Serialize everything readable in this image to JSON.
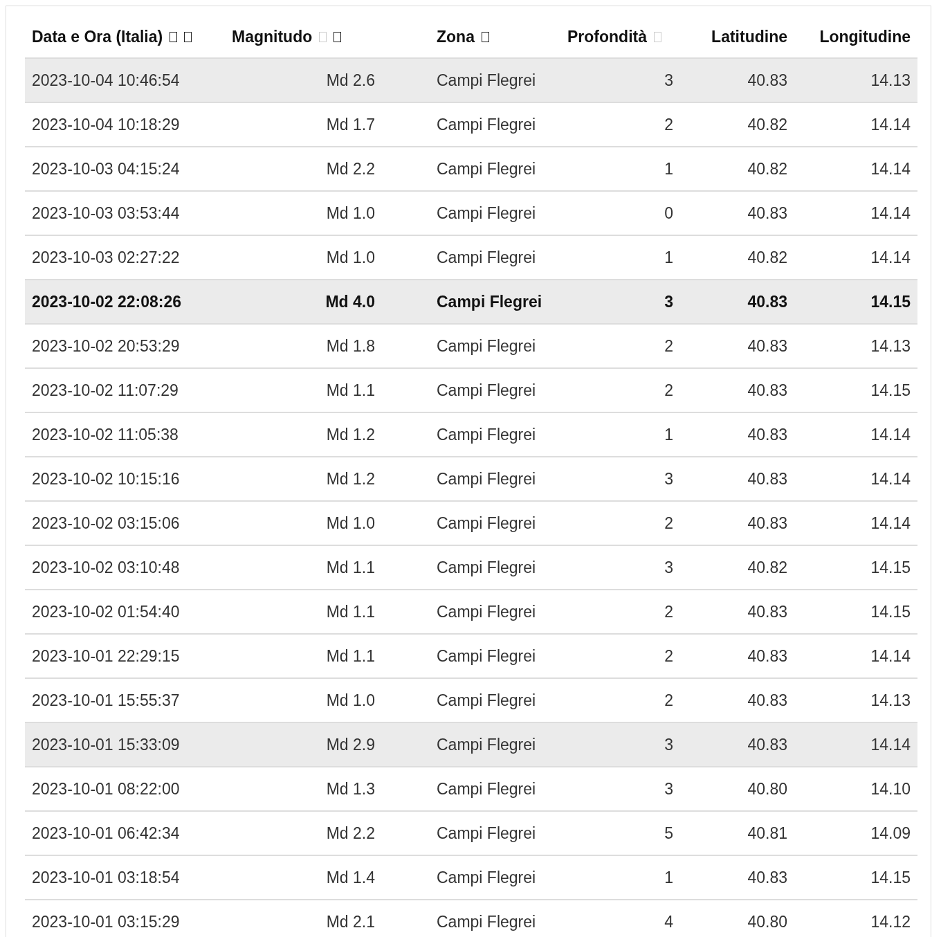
{
  "table": {
    "columns": [
      {
        "label": "Data e Ora (Italia)",
        "sort_icons": [
          {
            "dimmed": false
          },
          {
            "dimmed": false
          }
        ]
      },
      {
        "label": "Magnitudo",
        "sort_icons": [
          {
            "dimmed": true
          },
          {
            "dimmed": false
          }
        ]
      },
      {
        "label": "Zona",
        "sort_icons": [
          {
            "dimmed": false
          }
        ]
      },
      {
        "label": "Profondità",
        "sort_icons": [
          {
            "dimmed": true
          }
        ]
      },
      {
        "label": "Latitudine"
      },
      {
        "label": "Longitudine"
      }
    ],
    "rows": [
      {
        "highlighted": true,
        "bold": false,
        "cells": [
          "2023-10-04 10:46:54",
          "Md 2.6",
          "Campi Flegrei",
          "3",
          "40.83",
          "14.13"
        ]
      },
      {
        "highlighted": false,
        "bold": false,
        "cells": [
          "2023-10-04 10:18:29",
          "Md 1.7",
          "Campi Flegrei",
          "2",
          "40.82",
          "14.14"
        ]
      },
      {
        "highlighted": false,
        "bold": false,
        "cells": [
          "2023-10-03 04:15:24",
          "Md 2.2",
          "Campi Flegrei",
          "1",
          "40.82",
          "14.14"
        ]
      },
      {
        "highlighted": false,
        "bold": false,
        "cells": [
          "2023-10-03 03:53:44",
          "Md 1.0",
          "Campi Flegrei",
          "0",
          "40.83",
          "14.14"
        ]
      },
      {
        "highlighted": false,
        "bold": false,
        "cells": [
          "2023-10-03 02:27:22",
          "Md 1.0",
          "Campi Flegrei",
          "1",
          "40.82",
          "14.14"
        ]
      },
      {
        "highlighted": true,
        "bold": true,
        "cells": [
          "2023-10-02 22:08:26",
          "Md 4.0",
          "Campi Flegrei",
          "3",
          "40.83",
          "14.15"
        ]
      },
      {
        "highlighted": false,
        "bold": false,
        "cells": [
          "2023-10-02 20:53:29",
          "Md 1.8",
          "Campi Flegrei",
          "2",
          "40.83",
          "14.13"
        ]
      },
      {
        "highlighted": false,
        "bold": false,
        "cells": [
          "2023-10-02 11:07:29",
          "Md 1.1",
          "Campi Flegrei",
          "2",
          "40.83",
          "14.15"
        ]
      },
      {
        "highlighted": false,
        "bold": false,
        "cells": [
          "2023-10-02 11:05:38",
          "Md 1.2",
          "Campi Flegrei",
          "1",
          "40.83",
          "14.14"
        ]
      },
      {
        "highlighted": false,
        "bold": false,
        "cells": [
          "2023-10-02 10:15:16",
          "Md 1.2",
          "Campi Flegrei",
          "3",
          "40.83",
          "14.14"
        ]
      },
      {
        "highlighted": false,
        "bold": false,
        "cells": [
          "2023-10-02 03:15:06",
          "Md 1.0",
          "Campi Flegrei",
          "2",
          "40.83",
          "14.14"
        ]
      },
      {
        "highlighted": false,
        "bold": false,
        "cells": [
          "2023-10-02 03:10:48",
          "Md 1.1",
          "Campi Flegrei",
          "3",
          "40.82",
          "14.15"
        ]
      },
      {
        "highlighted": false,
        "bold": false,
        "cells": [
          "2023-10-02 01:54:40",
          "Md 1.1",
          "Campi Flegrei",
          "2",
          "40.83",
          "14.15"
        ]
      },
      {
        "highlighted": false,
        "bold": false,
        "cells": [
          "2023-10-01 22:29:15",
          "Md 1.1",
          "Campi Flegrei",
          "2",
          "40.83",
          "14.14"
        ]
      },
      {
        "highlighted": false,
        "bold": false,
        "cells": [
          "2023-10-01 15:55:37",
          "Md 1.0",
          "Campi Flegrei",
          "2",
          "40.83",
          "14.13"
        ]
      },
      {
        "highlighted": true,
        "bold": false,
        "cells": [
          "2023-10-01 15:33:09",
          "Md 2.9",
          "Campi Flegrei",
          "3",
          "40.83",
          "14.14"
        ]
      },
      {
        "highlighted": false,
        "bold": false,
        "cells": [
          "2023-10-01 08:22:00",
          "Md 1.3",
          "Campi Flegrei",
          "3",
          "40.80",
          "14.10"
        ]
      },
      {
        "highlighted": false,
        "bold": false,
        "cells": [
          "2023-10-01 06:42:34",
          "Md 2.2",
          "Campi Flegrei",
          "5",
          "40.81",
          "14.09"
        ]
      },
      {
        "highlighted": false,
        "bold": false,
        "cells": [
          "2023-10-01 03:18:54",
          "Md 1.4",
          "Campi Flegrei",
          "1",
          "40.83",
          "14.15"
        ]
      },
      {
        "highlighted": false,
        "bold": false,
        "cells": [
          "2023-10-01 03:15:29",
          "Md 2.1",
          "Campi Flegrei",
          "4",
          "40.80",
          "14.12"
        ]
      }
    ]
  }
}
